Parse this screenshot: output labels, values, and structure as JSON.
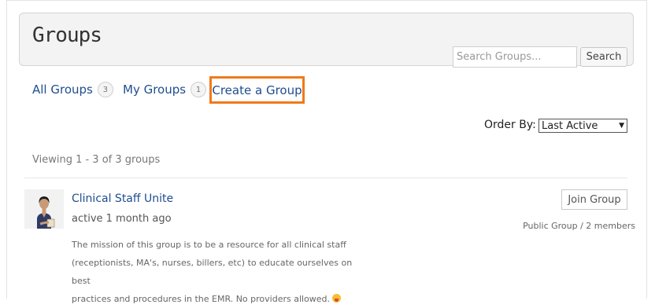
{
  "page": {
    "title": "Groups"
  },
  "search": {
    "placeholder": "Search Groups...",
    "button_label": "Search"
  },
  "tabs": [
    {
      "label": "All Groups",
      "count": "3"
    },
    {
      "label": "My Groups",
      "count": "1"
    }
  ],
  "create_group": {
    "label": "Create a Group",
    "highlight_color": "#f07a1a"
  },
  "order": {
    "label": "Order By:",
    "selected": "Last Active"
  },
  "viewing_text": "Viewing 1 - 3 of 3 groups",
  "groups": [
    {
      "name": "Clinical Staff Unite",
      "active": "active 1 month ago",
      "join_label": "Join Group",
      "meta": "Public Group / 2 members",
      "description": [
        "The mission of this group is to be a resource for all clinical staff",
        "(receptionists, MA's, nurses, billers, etc) to educate ourselves on best",
        "practices and procedures in the EMR. No providers allowed."
      ],
      "emoji_icon": "tongue-out-emoji-icon"
    }
  ],
  "colors": {
    "link": "#1f4d8f",
    "header_bg": "#f3f3f3"
  }
}
